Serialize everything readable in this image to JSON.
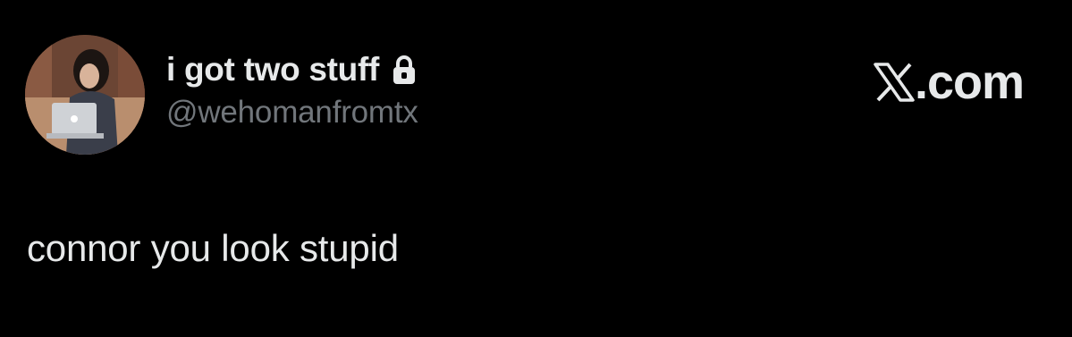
{
  "author": {
    "display_name": "i got two stuff",
    "handle": "@wehomanfromtx",
    "protected_icon": "lock-icon",
    "avatar_icon": "profile-photo"
  },
  "brand": {
    "logo_icon": "x-logo-icon",
    "text": ".com"
  },
  "tweet": {
    "text": "connor you look stupid"
  },
  "colors": {
    "background": "#000000",
    "primary_text": "#e7e9ea",
    "secondary_text": "#71767b"
  }
}
